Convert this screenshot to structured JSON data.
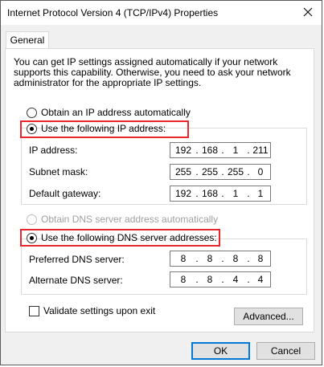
{
  "window": {
    "title": "Internet Protocol Version 4 (TCP/IPv4) Properties",
    "close_icon": "close-icon"
  },
  "tabs": [
    {
      "label": "General"
    }
  ],
  "description": "You can get IP settings assigned automatically if your network supports this capability. Otherwise, you need to ask your network administrator for the appropriate IP settings.",
  "ip_section": {
    "auto_label": "Obtain an IP address automatically",
    "manual_label": "Use the following IP address:",
    "selected": "manual",
    "fields": [
      {
        "label": "IP address:",
        "octets": [
          "192",
          "168",
          "1",
          "211"
        ]
      },
      {
        "label": "Subnet mask:",
        "octets": [
          "255",
          "255",
          "255",
          "0"
        ]
      },
      {
        "label": "Default gateway:",
        "octets": [
          "192",
          "168",
          "1",
          "1"
        ]
      }
    ]
  },
  "dns_section": {
    "auto_label": "Obtain DNS server address automatically",
    "manual_label": "Use the following DNS server addresses:",
    "selected": "manual",
    "fields": [
      {
        "label": "Preferred DNS server:",
        "octets": [
          "8",
          "8",
          "8",
          "8"
        ]
      },
      {
        "label": "Alternate DNS server:",
        "octets": [
          "8",
          "8",
          "4",
          "4"
        ]
      }
    ]
  },
  "validate": {
    "label": "Validate settings upon exit",
    "checked": false
  },
  "buttons": {
    "advanced": "Advanced...",
    "ok": "OK",
    "cancel": "Cancel"
  },
  "colors": {
    "highlight": "#e8262c",
    "default_button_border": "#0078d7"
  }
}
